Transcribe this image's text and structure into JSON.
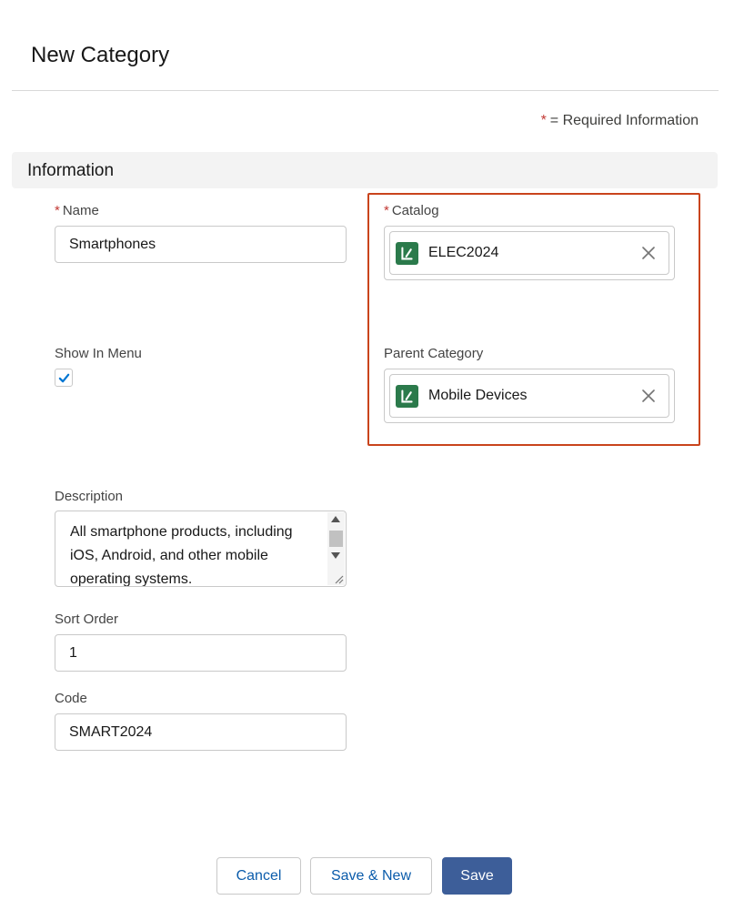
{
  "modal": {
    "title": "New Category",
    "required_star": "*",
    "required_legend": "= Required Information"
  },
  "section": {
    "title": "Information"
  },
  "fields": {
    "name": {
      "label": "Name",
      "required_star": "*",
      "value": "Smartphones"
    },
    "catalog": {
      "label": "Catalog",
      "required_star": "*",
      "value": "ELEC2024",
      "icon": "catalog-record-icon"
    },
    "show_in_menu": {
      "label": "Show In Menu",
      "checked": true
    },
    "parent_category": {
      "label": "Parent Category",
      "value": "Mobile Devices",
      "icon": "catalog-record-icon"
    },
    "description": {
      "label": "Description",
      "value": "All smartphone products, including iOS, Android, and other mobile operating systems."
    },
    "sort_order": {
      "label": "Sort Order",
      "value": "1"
    },
    "code": {
      "label": "Code",
      "value": "SMART2024"
    }
  },
  "footer": {
    "cancel_label": "Cancel",
    "save_new_label": "Save & New",
    "save_label": "Save"
  },
  "colors": {
    "brand_button": "#3d5e99",
    "required_star": "#c23934",
    "highlight_border": "#c9441c",
    "record_icon": "#2b7a4b",
    "checkbox_check": "#0176d3"
  }
}
